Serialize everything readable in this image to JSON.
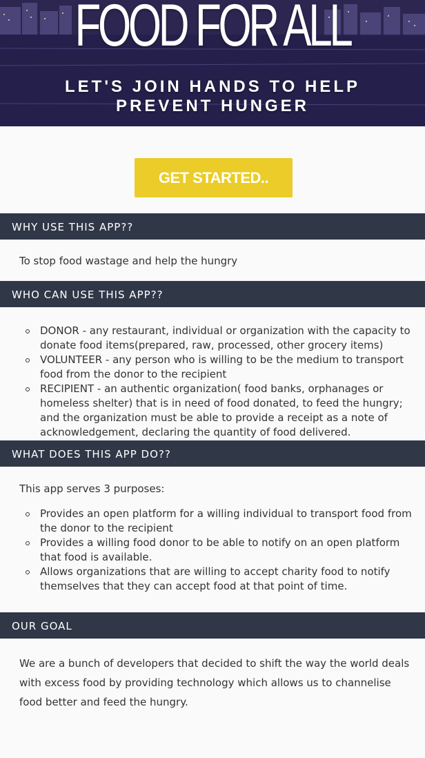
{
  "hero": {
    "title": "FOOD FOR ALL",
    "subtitle": "LET'S JOIN HANDS TO HELP PREVENT HUNGER"
  },
  "cta": {
    "label": "GET STARTED.."
  },
  "sections": {
    "why": {
      "header": "WHY USE THIS APP??",
      "text": "To stop food wastage and help the hungry"
    },
    "who": {
      "header": "WHO CAN USE THIS APP??",
      "items": [
        "DONOR - any restaurant, individual or organization with the capacity to donate food items(prepared, raw, processed, other grocery items)",
        "VOLUNTEER - any person who is willing to be the medium to transport food from the donor to the recipient",
        "RECIPIENT - an authentic organization( food banks, orphanages or homeless shelter) that is in need of food donated, to feed the hungry; and the organization must be able to provide a receipt as a note of acknowledgement, declaring the quantity of food delivered."
      ]
    },
    "what": {
      "header": "WHAT DOES THIS APP DO??",
      "intro": "This app serves 3 purposes:",
      "items": [
        "Provides an open platform for a willing individual to transport food from the donor to the recipient",
        "Provides a willing food donor to be able to notify on an open platform that food is available.",
        "Allows organizations that are willing to accept charity food to notify themselves that they can accept food at that point of time."
      ]
    },
    "goal": {
      "header": "OUR GOAL",
      "text": "We are a bunch of developers that decided to shift the way the world deals with excess food by providing technology which allows us to channelise food better and feed the hungry."
    }
  },
  "colors": {
    "header_bg": "#303747",
    "cta_bg": "#ebcc28",
    "page_bg": "#fafafa"
  }
}
